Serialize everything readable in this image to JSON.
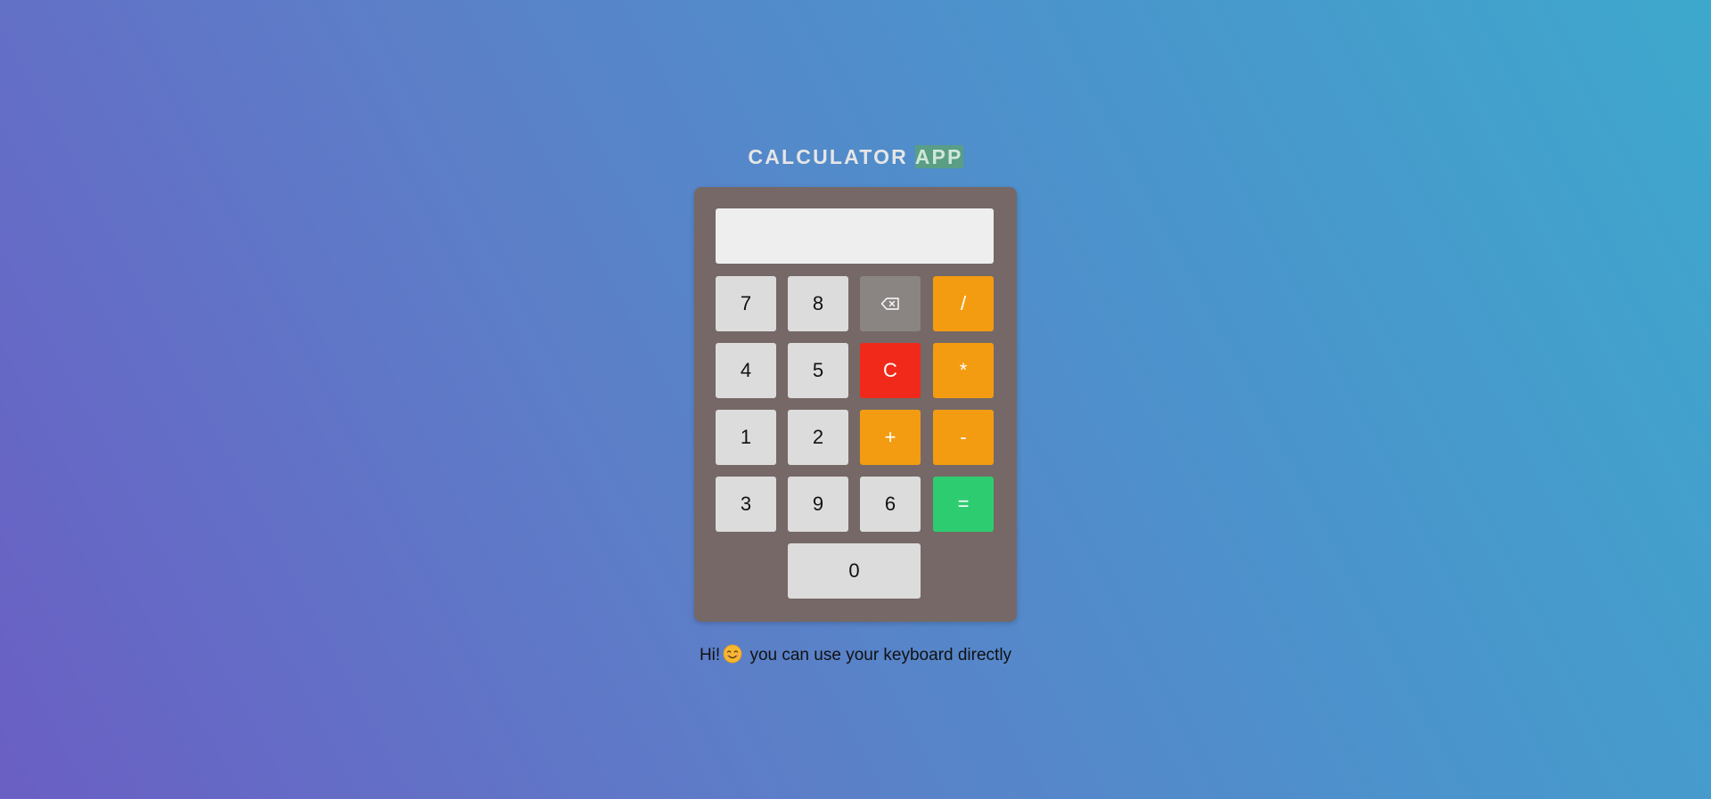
{
  "title": {
    "main": "CALCULATOR ",
    "highlight": "APP"
  },
  "display": {
    "value": ""
  },
  "keys": {
    "seven": "7",
    "eight": "8",
    "backspace_icon": "backspace-icon",
    "divide": "/",
    "four": "4",
    "five": "5",
    "clear": "C",
    "multiply": "*",
    "one": "1",
    "two": "2",
    "plus": "+",
    "minus": "-",
    "three": "3",
    "nine": "9",
    "six": "6",
    "equals": "=",
    "zero": "0"
  },
  "colors": {
    "operator": "#f39c12",
    "clear": "#f0291a",
    "backspace": "#8a8583",
    "equals": "#2ecc71",
    "number": "#dcdcdc",
    "body": "#756866"
  },
  "hint": {
    "prefix": "Hi!",
    "emoji_icon": "smiling-face-icon",
    "text": " you can use your keyboard directly"
  }
}
